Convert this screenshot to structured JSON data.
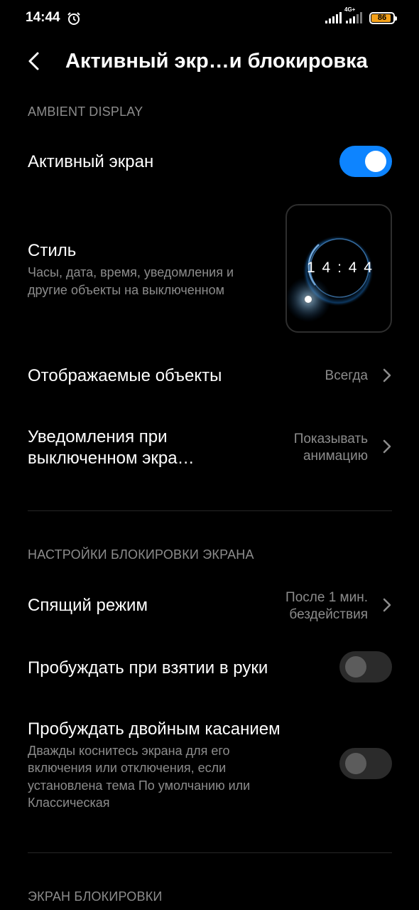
{
  "status_bar": {
    "time": "14:44",
    "network_label": "4G+",
    "battery": "86"
  },
  "header": {
    "title": "Активный экр…и блокировка"
  },
  "ambient_section": {
    "title": "AMBIENT DISPLAY",
    "active_screen": {
      "label": "Активный экран",
      "enabled": true
    },
    "style": {
      "label": "Стиль",
      "description_line1": "Часы, дата, время, уведомления и",
      "description_line2": "другие объекты на выключенном",
      "preview_clock": "1 4 : 4 4"
    },
    "displayed_objects": {
      "label": "Отображаемые объекты",
      "value": "Всегда"
    },
    "notifications": {
      "label_line1": "Уведомления при",
      "label_line2": "выключенном экра…",
      "value_line1": "Показывать",
      "value_line2": "анимацию"
    }
  },
  "lock_settings_section": {
    "title": "НАСТРОЙКИ БЛОКИРОВКИ ЭКРАНА",
    "sleep": {
      "label": "Спящий режим",
      "value_line1": "После 1 мин.",
      "value_line2": "бездействия"
    },
    "wake_on_pickup": {
      "label": "Пробуждать при взятии в руки",
      "enabled": false
    },
    "wake_double_tap": {
      "label": "Пробуждать двойным касанием",
      "description_line1": "Дважды коснитесь экрана для его",
      "description_line2": "включения или отключения, если",
      "description_line3": "установлена тема По умолчанию или",
      "description_line4": "Классическая",
      "enabled": false
    }
  },
  "lock_screen_section": {
    "title": "ЭКРАН БЛОКИРОВКИ"
  },
  "colors": {
    "accent": "#0d84ff",
    "battery": "#f4a11a",
    "secondary_text": "#8c8c8c"
  }
}
